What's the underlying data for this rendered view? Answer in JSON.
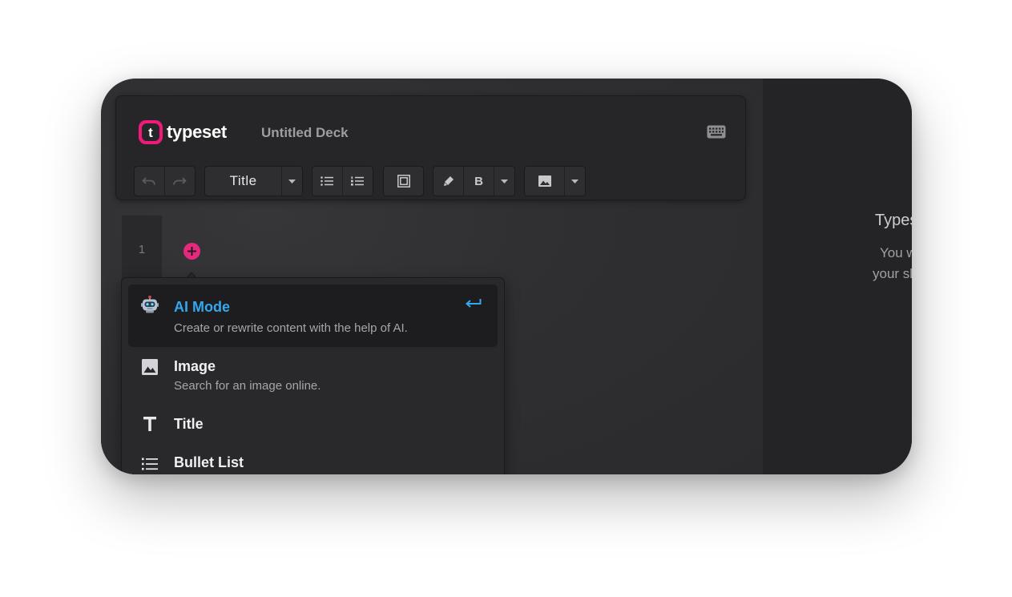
{
  "app": {
    "brand": "typeset",
    "logo_letter": "t",
    "deck_title": "Untitled Deck"
  },
  "toolbar": {
    "block_type_selected": "Title",
    "bold_label": "B"
  },
  "slides": {
    "current_number": "1"
  },
  "insert_menu": {
    "items": [
      {
        "label": "AI Mode",
        "description": "Create or rewrite content with the help of AI.",
        "icon": "robot-icon",
        "active": true
      },
      {
        "label": "Image",
        "description": "Search for an image online.",
        "icon": "image-icon"
      },
      {
        "label": "Title",
        "description": "",
        "icon": "text-t-icon"
      },
      {
        "label": "Bullet List",
        "description": "",
        "icon": "bullet-list-icon"
      }
    ]
  },
  "right_panel": {
    "title": "Typeset is a",
    "line1": "You write ov",
    "line2": "your slides wi"
  },
  "colors": {
    "brand": "#ef1a7a",
    "accent": "#33a8ee",
    "background": "#2c2c2f"
  }
}
